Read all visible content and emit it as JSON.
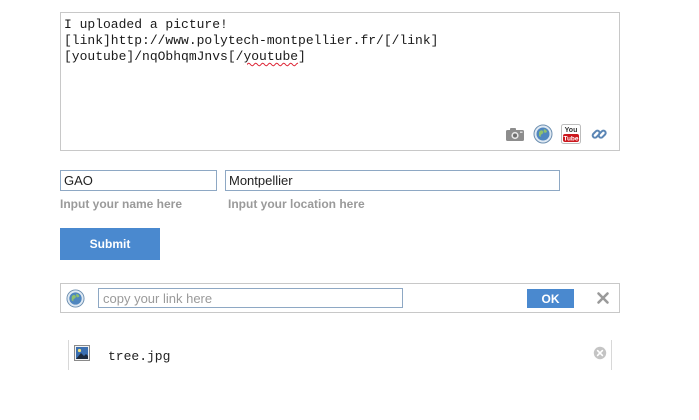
{
  "composer": {
    "line1": "I uploaded a picture!",
    "line2": "[link]http://www.polytech-montpellier.fr/[/link]",
    "line3_prefix": "[youtube]/nqObhqmJnvs[/",
    "line3_word": "youtube",
    "line3_suffix": "]"
  },
  "toolbar": [
    "camera-icon",
    "globe-icon",
    "youtube-icon",
    "link-icon"
  ],
  "form": {
    "name_value": "GAO",
    "name_hint": "Input your name here",
    "location_value": "Montpellier",
    "location_hint": "Input your location here",
    "submit_label": "Submit"
  },
  "link_bar": {
    "placeholder": "copy your link here",
    "ok_label": "OK"
  },
  "attachment": {
    "file_name": "tree.jpg"
  },
  "colors": {
    "accent": "#4a89cf",
    "hint": "#9a9a9a",
    "border": "#c8c8c8",
    "youtube_red": "#cc181e"
  }
}
